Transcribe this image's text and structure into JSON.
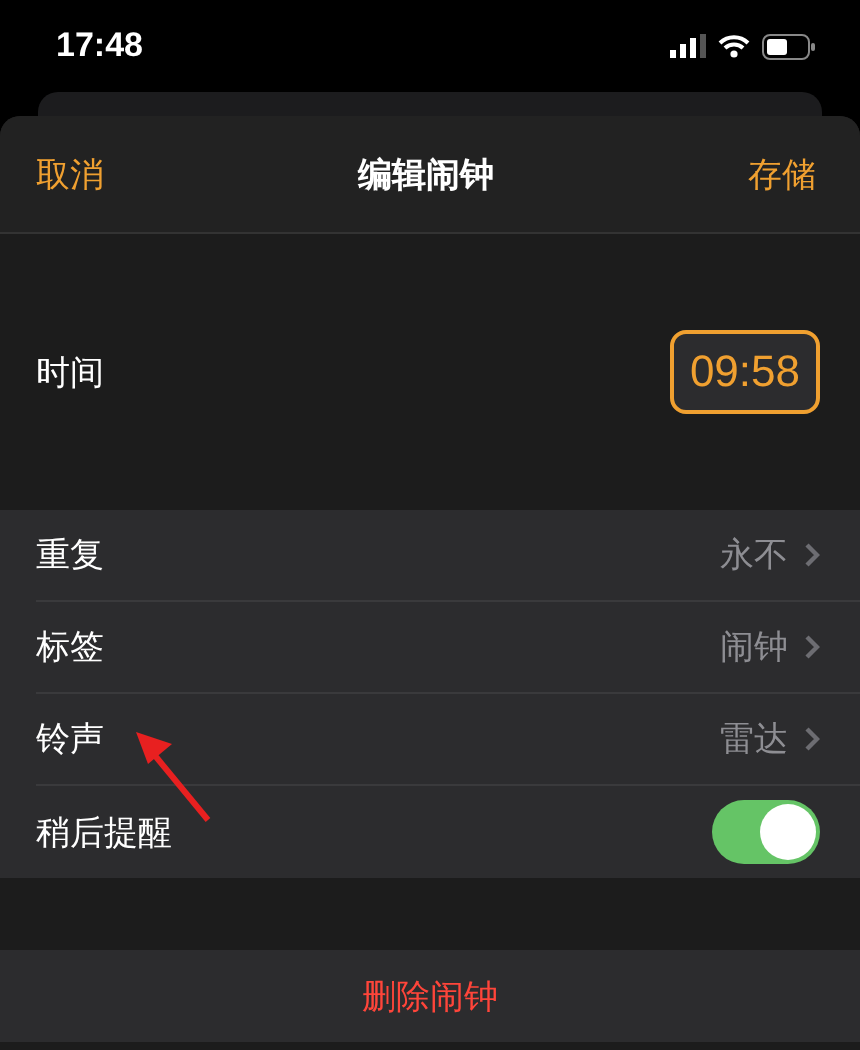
{
  "status_bar": {
    "time": "17:48"
  },
  "nav": {
    "cancel": "取消",
    "title": "编辑闹钟",
    "save": "存储"
  },
  "time_row": {
    "label": "时间",
    "value": "09:58"
  },
  "rows": [
    {
      "kind": "link",
      "label": "重复",
      "value": "永不"
    },
    {
      "kind": "link",
      "label": "标签",
      "value": "闹钟"
    },
    {
      "kind": "link",
      "label": "铃声",
      "value": "雷达"
    },
    {
      "kind": "toggle",
      "label": "稍后提醒",
      "on": true
    }
  ],
  "delete_button": "删除闹钟"
}
